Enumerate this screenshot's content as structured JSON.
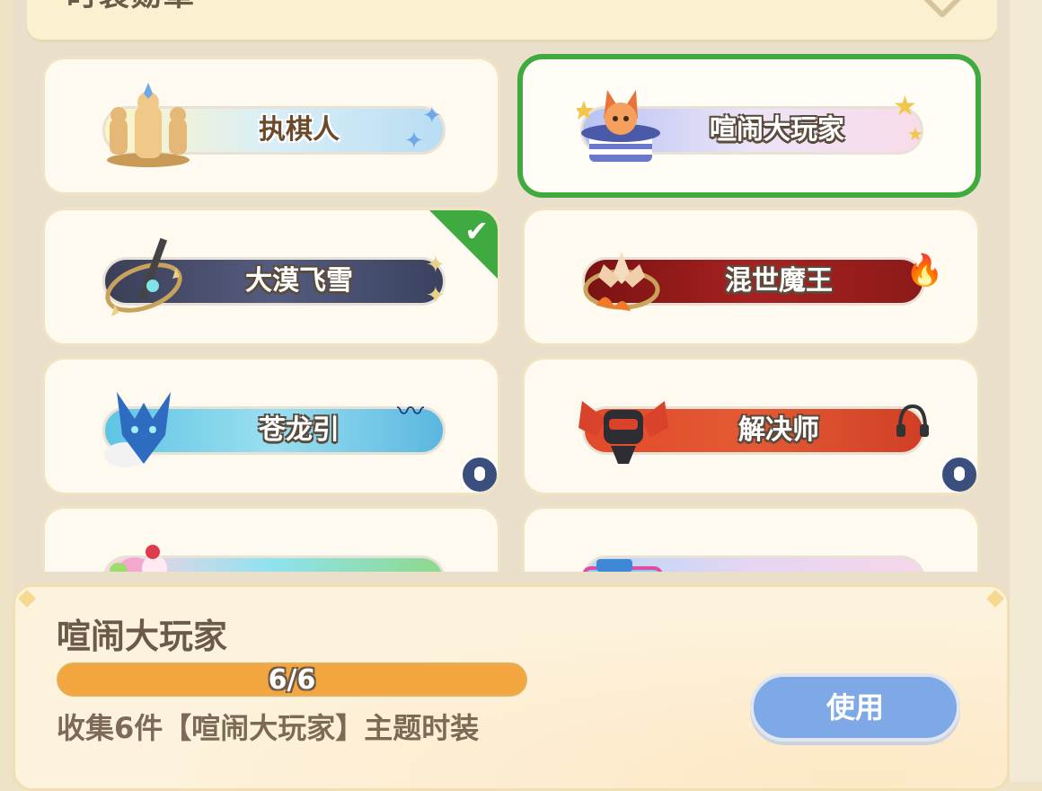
{
  "header": {
    "title": "时装勋章"
  },
  "colors": {
    "selected_border": "#3faa3f",
    "progress": "#f3a53f",
    "use_button": "#7ea8e6",
    "lock_badge": "#3b4f7e"
  },
  "badges": [
    {
      "label": "执棋人",
      "icon": "chess-pieces-icon",
      "status": "available"
    },
    {
      "label": "喧闹大玩家",
      "icon": "fox-hat-icon",
      "status": "selected"
    },
    {
      "label": "大漠飞雪",
      "icon": "sword-ring-icon",
      "status": "equipped"
    },
    {
      "label": "混世魔王",
      "icon": "lotus-fire-icon",
      "status": "available"
    },
    {
      "label": "苍龙引",
      "icon": "dragon-head-icon",
      "status": "locked"
    },
    {
      "label": "解决师",
      "icon": "robot-mask-icon",
      "status": "locked"
    },
    {
      "label": "",
      "icon": "dessert-icon",
      "status": "partial"
    },
    {
      "label": "",
      "icon": "sunglasses-icon",
      "status": "partial"
    }
  ],
  "detail": {
    "title": "喧闹大玩家",
    "progress_text": "6/6",
    "progress_fraction": 1.0,
    "description": "收集6件【喧闹大玩家】主题时装",
    "use_button": "使用"
  }
}
